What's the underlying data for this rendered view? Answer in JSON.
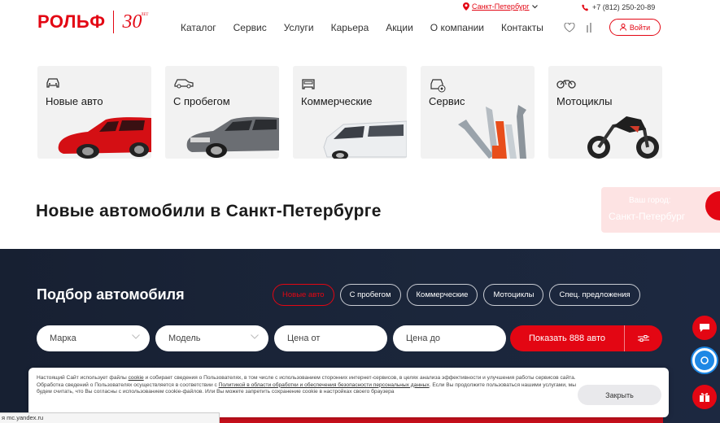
{
  "header": {
    "logo_text": "РОЛЬФ",
    "logo_years": "30",
    "logo_years_sup": "ЛЕТ",
    "city": "Санкт-Петербург",
    "phone": "+7 (812) 250-20-89",
    "login": "Войти",
    "nav": [
      "Каталог",
      "Сервис",
      "Услуги",
      "Карьера",
      "Акции",
      "О компании",
      "Контакты"
    ]
  },
  "categories": [
    {
      "label": "Новые авто",
      "icon": "car-icon"
    },
    {
      "label": "С пробегом",
      "icon": "used-car-icon"
    },
    {
      "label": "Коммерческие",
      "icon": "van-icon"
    },
    {
      "label": "Сервис",
      "icon": "service-icon"
    },
    {
      "label": "Мотоциклы",
      "icon": "motorcycle-icon"
    }
  ],
  "page_title": "Новые автомобили в Санкт-Петербурге",
  "city_popup": {
    "line1": "Ваш город:",
    "line2": "Санкт-Петербург"
  },
  "picker": {
    "title": "Подбор автомобиля",
    "chips": [
      "Новые авто",
      "С пробегом",
      "Коммерческие",
      "Мотоциклы",
      "Спец. предложения"
    ],
    "fields": {
      "brand": "Марка",
      "model": "Модель",
      "price_from": "Цена от",
      "price_to": "Цена до"
    },
    "show_button": "Показать 888 авто"
  },
  "cookie": {
    "t1": "Настоящий Сайт использует файлы ",
    "link1": "cookie",
    "t2": " и собирает сведения о Пользователях, в том числе с использованием сторонних интернет-сервисов, в целях анализа эффективности и улучшения работы сервисов сайта. Обработка сведений о Пользователях осуществляется в соответствии с ",
    "link2": "Политикой в области обработки и обеспечения безопасности персональных данных",
    "t3": ". Если Вы продолжите пользоваться нашими услугами, мы будем считать, что Вы согласны с использованием cookie-файлов. Или Вы можете запретить сохранение cookie в настройках своего браузера",
    "close": "Закрыть"
  },
  "status_bar": "я mc.yandex.ru",
  "colors": {
    "brand": "#e30613",
    "dark_bg": "#1b263b"
  }
}
